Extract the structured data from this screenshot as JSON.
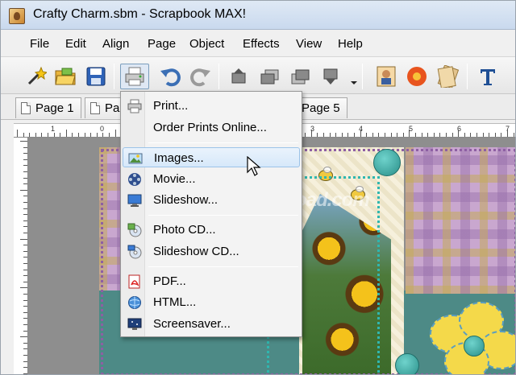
{
  "window": {
    "title": "Crafty Charm.sbm - Scrapbook MAX!"
  },
  "menubar": {
    "items": [
      {
        "label": "File"
      },
      {
        "label": "Edit"
      },
      {
        "label": "Align"
      },
      {
        "label": "Page"
      },
      {
        "label": "Object"
      },
      {
        "label": "Effects"
      },
      {
        "label": "View"
      },
      {
        "label": "Help"
      }
    ]
  },
  "toolbar": {
    "buttons": [
      {
        "icon": "magic-wand-icon"
      },
      {
        "icon": "open-folder-icon"
      },
      {
        "icon": "save-disk-icon"
      },
      {
        "icon": "printer-icon",
        "state": "pressed"
      },
      {
        "icon": "undo-icon"
      },
      {
        "icon": "redo-icon"
      },
      {
        "icon": "bring-to-front-icon"
      },
      {
        "icon": "bring-forward-icon"
      },
      {
        "icon": "send-backward-icon"
      },
      {
        "icon": "send-to-back-icon"
      },
      {
        "icon": "photo-frame-icon"
      },
      {
        "icon": "flower-embellishment-icon"
      },
      {
        "icon": "paper-icon"
      },
      {
        "icon": "text-tool-icon"
      }
    ]
  },
  "page_tabs": [
    {
      "label": "Page 1"
    },
    {
      "label": "Pa"
    },
    {
      "label": "Page 5"
    }
  ],
  "ruler": {
    "numbers": [
      "1",
      "0",
      "1",
      "2",
      "3",
      "4",
      "5",
      "6",
      "7",
      "8"
    ]
  },
  "dropdown_menu": {
    "items": [
      {
        "label": "Print...",
        "icon": "printer-icon"
      },
      {
        "label": "Order Prints Online...",
        "icon": ""
      },
      {
        "separator": true
      },
      {
        "label": "Images...",
        "icon": "image-icon",
        "state": "hover"
      },
      {
        "label": "Movie...",
        "icon": "movie-reel-icon"
      },
      {
        "label": "Slideshow...",
        "icon": "monitor-icon"
      },
      {
        "separator": true
      },
      {
        "label": "Photo CD...",
        "icon": "photo-cd-icon"
      },
      {
        "label": "Slideshow CD...",
        "icon": "slideshow-cd-icon"
      },
      {
        "separator": true
      },
      {
        "label": "PDF...",
        "icon": "pdf-icon"
      },
      {
        "label": "HTML...",
        "icon": "html-globe-icon"
      },
      {
        "label": "Screensaver...",
        "icon": "screensaver-icon"
      }
    ]
  },
  "watermark": {
    "text": "Download.com"
  },
  "colors": {
    "accent": "#3399ff",
    "teal": "#4d8a86",
    "dotted": "#2fb7b0",
    "plaid": "#c9a7cf"
  }
}
